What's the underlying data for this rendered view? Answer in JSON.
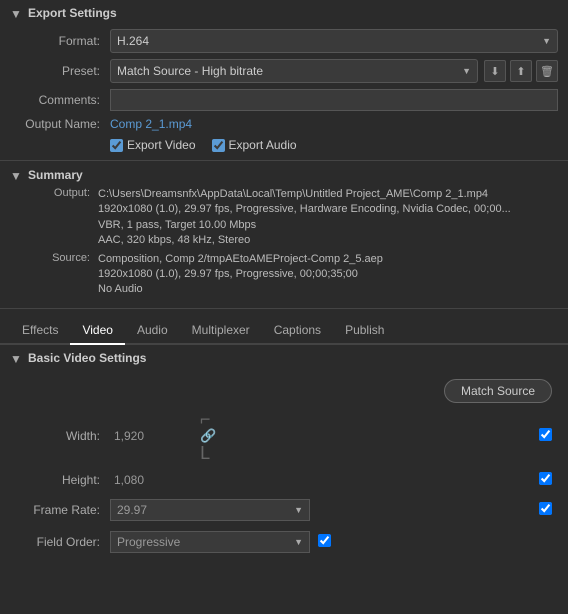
{
  "export_settings": {
    "header": "Export Settings",
    "format_label": "Format:",
    "format_value": "H.264",
    "preset_label": "Preset:",
    "preset_value": "Match Source - High bitrate",
    "comments_label": "Comments:",
    "comments_placeholder": "",
    "output_name_label": "Output Name:",
    "output_name_value": "Comp 2_1.mp4",
    "export_video_label": "Export Video",
    "export_audio_label": "Export Audio",
    "summary_header": "Summary",
    "output_key": "Output:",
    "output_value_line1": "C:\\Users\\Dreamsnfx\\AppData\\Local\\Temp\\Untitled Project_AME\\Comp 2_1.mp4",
    "output_value_line2": "1920x1080 (1.0), 29.97 fps, Progressive, Hardware Encoding, Nvidia Codec, 00;00...",
    "output_value_line3": "VBR, 1 pass, Target 10.00 Mbps",
    "output_value_line4": "AAC, 320 kbps, 48 kHz, Stereo",
    "source_key": "Source:",
    "source_value_line1": "Composition, Comp 2/tmpAEtoAMEProject-Comp 2_5.aep",
    "source_value_line2": "1920x1080 (1.0), 29.97 fps, Progressive, 00;00;35;00",
    "source_value_line3": "No Audio"
  },
  "tabs": {
    "items": [
      {
        "id": "effects",
        "label": "Effects"
      },
      {
        "id": "video",
        "label": "Video"
      },
      {
        "id": "audio",
        "label": "Audio"
      },
      {
        "id": "multiplexer",
        "label": "Multiplexer"
      },
      {
        "id": "captions",
        "label": "Captions"
      },
      {
        "id": "publish",
        "label": "Publish"
      }
    ],
    "active": "video"
  },
  "basic_video_settings": {
    "header": "Basic Video Settings",
    "match_source_btn": "Match Source",
    "width_label": "Width:",
    "width_value": "1,920",
    "height_label": "Height:",
    "height_value": "1,080",
    "frame_rate_label": "Frame Rate:",
    "frame_rate_value": "29.97",
    "field_order_label": "Field Order:",
    "field_order_value": "Progressive"
  },
  "icons": {
    "collapse_down": "▼",
    "save": "⬇",
    "import": "↑",
    "delete": "🗑",
    "link": "🔗"
  }
}
